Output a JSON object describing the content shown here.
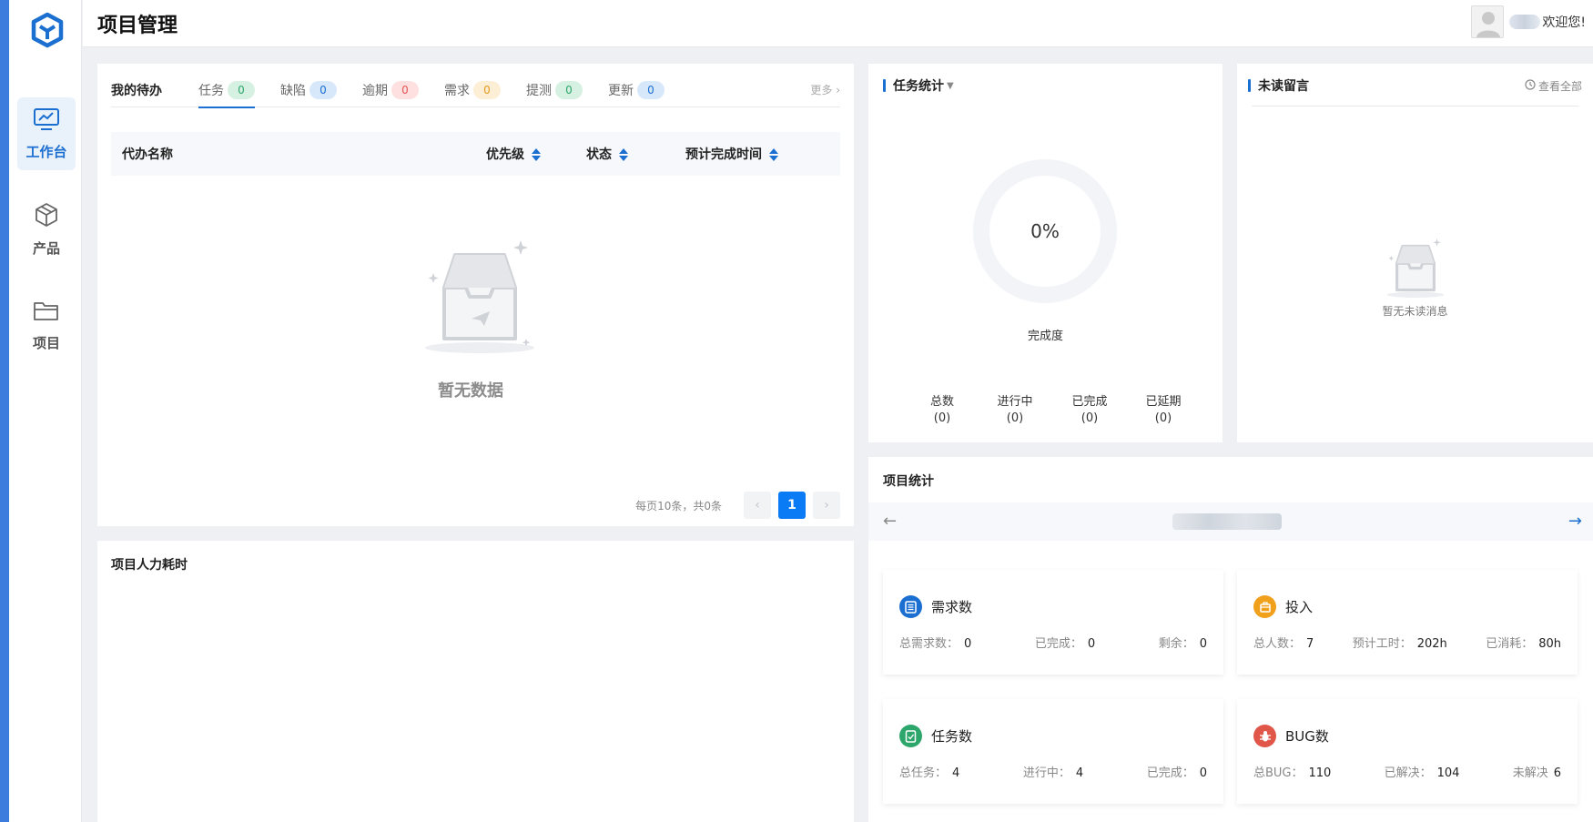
{
  "app": {
    "title": "项目管理",
    "welcome": "欢迎您!"
  },
  "sidebar": {
    "items": [
      {
        "label": "工作台",
        "icon": "monitor-chart-icon",
        "active": true
      },
      {
        "label": "产品",
        "icon": "cube-icon"
      },
      {
        "label": "项目",
        "icon": "folder-icon"
      }
    ]
  },
  "todo": {
    "title": "我的待办",
    "tabs": [
      {
        "label": "任务",
        "count": "0",
        "color": "#d6f1e2",
        "text_color": "#2ca66b"
      },
      {
        "label": "缺陷",
        "count": "0",
        "color": "#d8e8fb",
        "text_color": "#1b6fd1"
      },
      {
        "label": "逾期",
        "count": "0",
        "color": "#fde0df",
        "text_color": "#e05757"
      },
      {
        "label": "需求",
        "count": "0",
        "color": "#fdefd5",
        "text_color": "#e49a1e"
      },
      {
        "label": "提测",
        "count": "0",
        "color": "#d6f1e2",
        "text_color": "#2ca66b"
      },
      {
        "label": "更新",
        "count": "0",
        "color": "#d8e8fb",
        "text_color": "#1b6fd1"
      }
    ],
    "more": "更多",
    "columns": [
      "代办名称",
      "优先级",
      "状态",
      "预计完成时间"
    ],
    "empty": "暂无数据",
    "pagination": {
      "info": "每页10条，共0条",
      "current": "1"
    }
  },
  "task_stats": {
    "title": "任务统计",
    "percent": "0%",
    "completion_label": "完成度",
    "completion": 0,
    "items": [
      {
        "label": "总数",
        "value": "(0)"
      },
      {
        "label": "进行中",
        "value": "(0)"
      },
      {
        "label": "已完成",
        "value": "(0)"
      },
      {
        "label": "已延期",
        "value": "(0)"
      }
    ]
  },
  "messages": {
    "title": "未读留言",
    "view_all": "查看全部",
    "empty": "暂无未读消息"
  },
  "project_stats": {
    "title": "项目统计",
    "cards": [
      {
        "title": "需求数",
        "icon": "document-list-icon",
        "color": "#1b6fd1",
        "stats": [
          {
            "label": "总需求数：",
            "value": "0"
          },
          {
            "label": "已完成：",
            "value": "0"
          },
          {
            "label": "剩余：",
            "value": "0"
          }
        ]
      },
      {
        "title": "投入",
        "icon": "box-icon",
        "color": "#f0a01a",
        "stats": [
          {
            "label": "总人数：",
            "value": "7"
          },
          {
            "label": "预计工时：",
            "value": "202h"
          },
          {
            "label": "已消耗：",
            "value": "80h"
          }
        ]
      },
      {
        "title": "任务数",
        "icon": "task-check-icon",
        "color": "#2ca66b",
        "stats": [
          {
            "label": "总任务：",
            "value": "4"
          },
          {
            "label": "进行中：",
            "value": "4"
          },
          {
            "label": "已完成：",
            "value": "0"
          }
        ]
      },
      {
        "title": "BUG数",
        "icon": "bug-icon",
        "color": "#e0574a",
        "stats": [
          {
            "label": "总BUG：",
            "value": "110"
          },
          {
            "label": "已解决：",
            "value": "104"
          },
          {
            "label": "未解决",
            "value": "6"
          }
        ]
      }
    ]
  },
  "manpower": {
    "title": "项目人力耗时"
  }
}
